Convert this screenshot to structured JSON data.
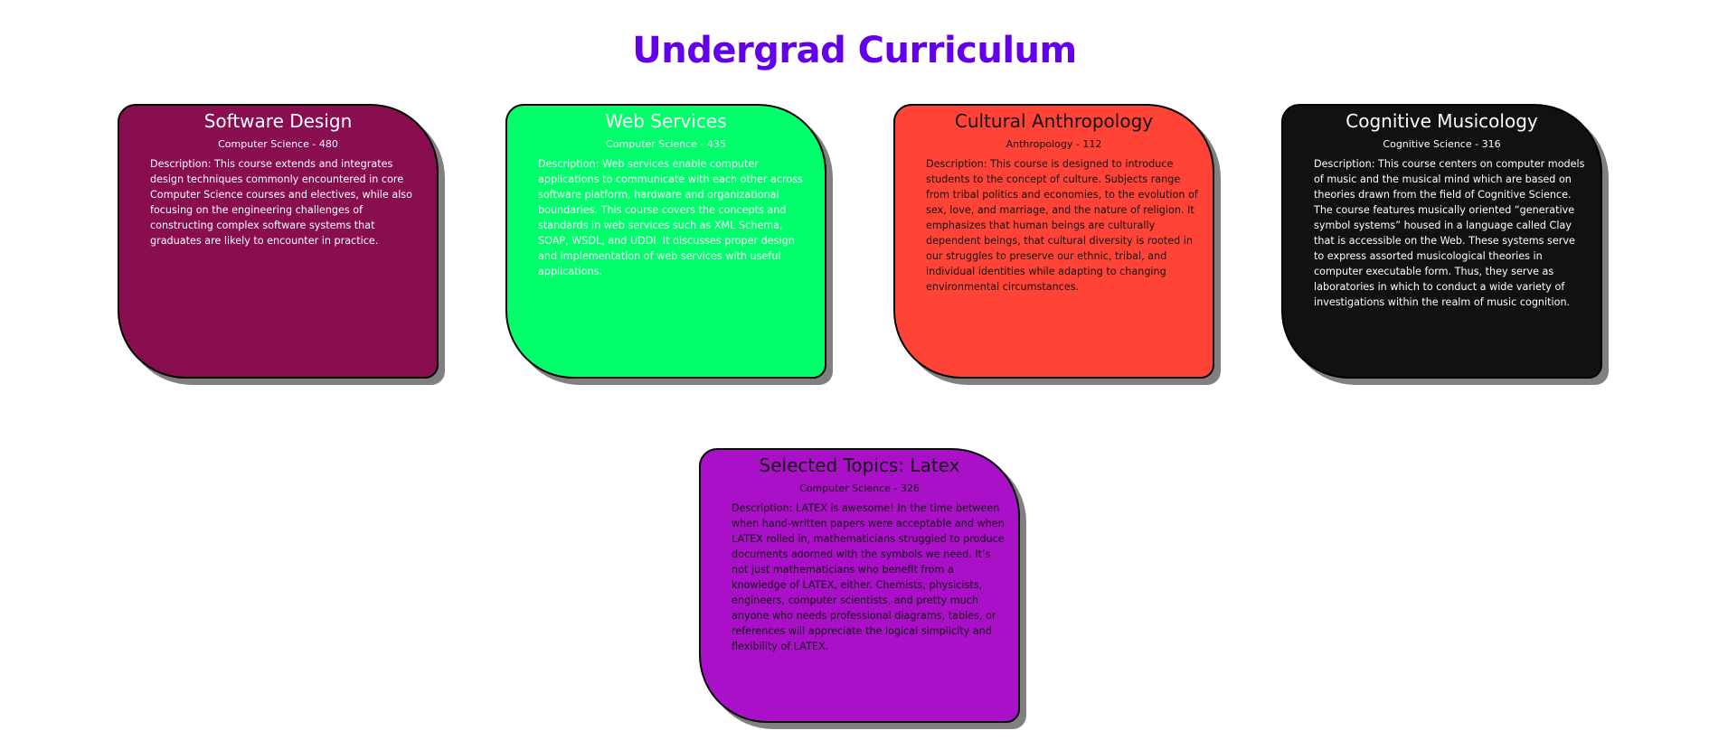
{
  "page": {
    "title": "Undergrad Curriculum",
    "title_color": "#6200ea"
  },
  "courses": [
    {
      "title": "Software Design",
      "subtitle": "Computer Science - 480",
      "description": "Description: This course extends and integrates design techniques commonly encountered in core Computer Science courses and electives, while also focusing on the engineering challenges of constructing complex software systems that graduates are likely to encounter in practice.",
      "background": "#880e4f",
      "text_color": "#ffffff"
    },
    {
      "title": "Web Services",
      "subtitle": "Computer Science - 435",
      "description": "Description: Web services enable computer applications to communicate with each other across software platform, hardware and organizational boundaries. This course covers the concepts and standards in web services such as XML Schema, SOAP, WSDL, and UDDI. It discusses proper design and implementation of web services with useful applications.",
      "background": "#00ff6a",
      "text_color": "#ffffff"
    },
    {
      "title": "Cultural Anthropology",
      "subtitle": "Anthropology - 112",
      "description": "Description: This course is designed to introduce students to the concept of culture. Subjects range from tribal politics and economies, to the evolution of sex, love, and marriage, and the nature of religion. It emphasizes that human beings are culturally dependent beings, that cultural diversity is rooted in our struggles to preserve our ethnic, tribal, and individual identities while adapting to changing environmental circumstances.",
      "background": "#ff4336",
      "text_color": "#111111"
    },
    {
      "title": "Cognitive Musicology",
      "subtitle": "Cognitive Science - 316",
      "description": "Description: This course centers on computer models of music and the musical mind which are based on theories drawn from the field of Cognitive Science. The course features musically oriented “generative symbol systems” housed in a language called Clay that is accessible on the Web. These systems serve to express assorted musicological theories in computer executable form. Thus, they serve as laboratories in which to conduct a wide variety of investigations within the realm of music cognition.",
      "background": "#111111",
      "text_color": "#ffffff"
    },
    {
      "title": "Selected Topics: Latex",
      "subtitle": "Computer Science - 326",
      "description": "Description: LATEX is awesome! In the time between when hand-written papers were acceptable and when LATEX rolled in, mathematicians struggled to produce documents adorned with the symbols we need. It’s not just mathematicians who benefit from a knowledge of LATEX, either. Chemists, physicists, engineers, computer scientists, and pretty much anyone who needs professional diagrams, tables, or references will appreciate the logical simplicity and flexibility of LATEX.",
      "background": "#aa10c8",
      "text_color": "#111111"
    }
  ]
}
